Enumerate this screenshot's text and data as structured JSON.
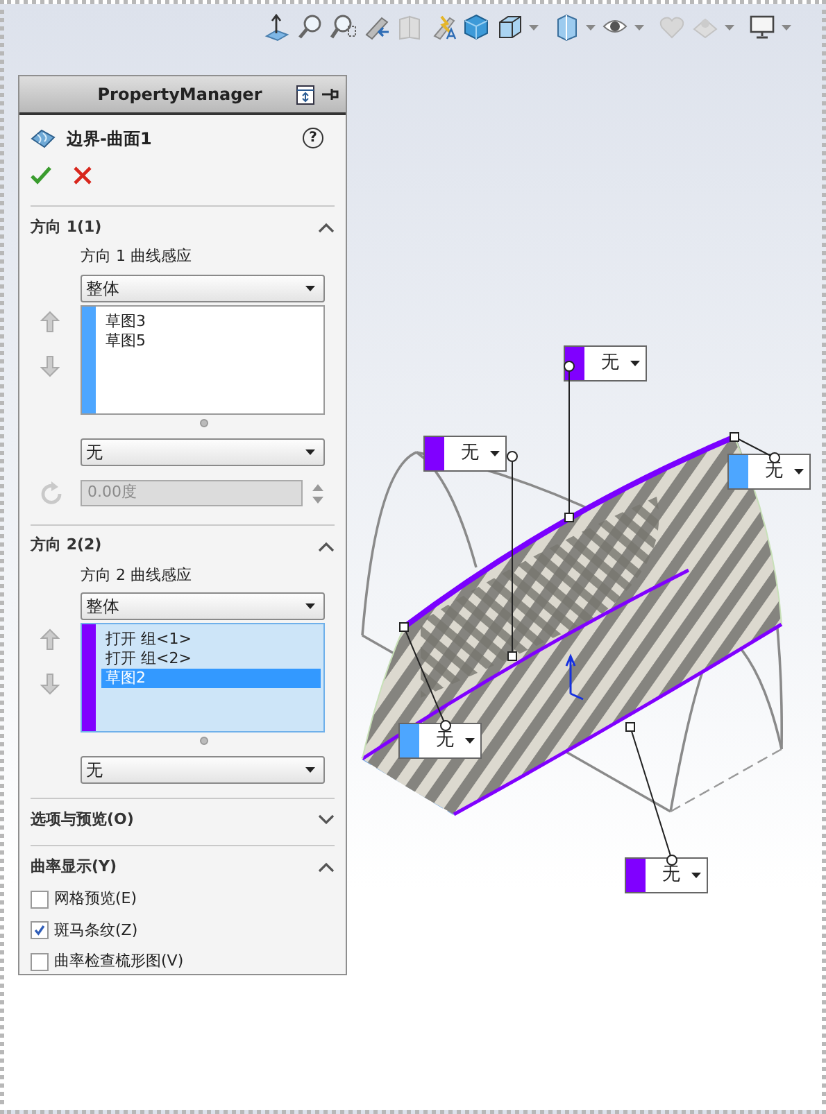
{
  "property_manager": {
    "header": "PropertyManager",
    "feature_title": "边界-曲面1",
    "help": "?",
    "sections": [
      {
        "kind": "direction",
        "title": "方向 1(1)",
        "expanded": true,
        "tangency_label": "方向 1 曲线感应",
        "tangency_value": "整体",
        "color": "#4da6ff",
        "list_active": false,
        "items": [
          {
            "label": "草图3",
            "selected": false
          },
          {
            "label": "草图5",
            "selected": false
          }
        ],
        "alignment_value": "无",
        "angle": {
          "value": "0.00度",
          "disabled": true
        }
      },
      {
        "kind": "direction",
        "title": "方向 2(2)",
        "expanded": true,
        "tangency_label": "方向 2 曲线感应",
        "tangency_value": "整体",
        "color": "#8000ff",
        "list_active": true,
        "items": [
          {
            "label": "打开 组<1>",
            "selected": false
          },
          {
            "label": "打开 组<2>",
            "selected": false
          },
          {
            "label": "草图2",
            "selected": true
          }
        ],
        "alignment_value": "无"
      },
      {
        "kind": "plain",
        "title": "选项与预览(O)",
        "expanded": false
      },
      {
        "kind": "checks",
        "title": "曲率显示(Y)",
        "expanded": true,
        "options": [
          {
            "label": "网格预览(E)",
            "checked": false
          },
          {
            "label": "斑马条纹(Z)",
            "checked": true
          },
          {
            "label": "曲率检查梳形图(V)",
            "checked": false
          }
        ]
      }
    ]
  },
  "callouts": [
    {
      "label": "无",
      "color": "#8000ff"
    },
    {
      "label": "无",
      "color": "#8000ff"
    },
    {
      "label": "无",
      "color": "#4da6ff"
    },
    {
      "label": "无",
      "color": "#4da6ff"
    },
    {
      "label": "无",
      "color": "#8000ff"
    }
  ]
}
